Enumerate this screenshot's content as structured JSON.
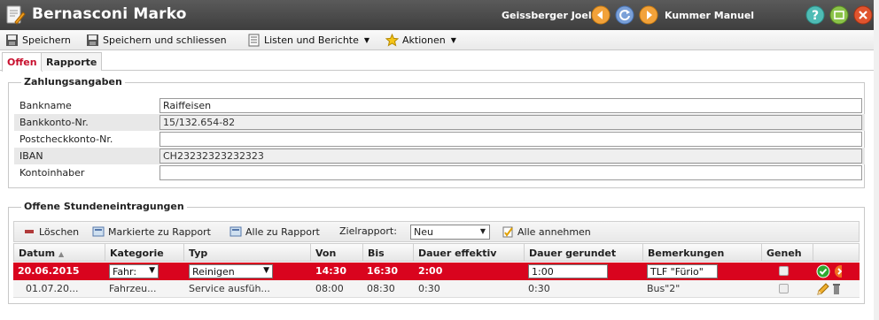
{
  "window": {
    "title": "Bernasconi Marko",
    "prev_name": "Geissberger Joel",
    "next_name": "Kummer Manuel"
  },
  "toolbar": {
    "save": "Speichern",
    "save_close": "Speichern und schliessen",
    "lists": "Listen und Berichte",
    "actions": "Aktionen"
  },
  "tabs": [
    "Offen",
    "Rapporte"
  ],
  "payment": {
    "legend": "Zahlungsangaben",
    "fields": [
      {
        "label": "Bankname",
        "value": ""
      },
      {
        "label": "Bankkonto-Nr.",
        "value": "15/132.654-82"
      },
      {
        "label": "Postcheckkonto-Nr.",
        "value": ""
      },
      {
        "label": "IBAN",
        "value": "CH23232323232323"
      },
      {
        "label": "Kontoinhaber",
        "value": ""
      }
    ],
    "bankname_value": "Raiffeisen"
  },
  "entries": {
    "legend": "Offene Stundeneintragungen",
    "toolbar": {
      "delete": "Löschen",
      "mark_to_report": "Markierte zu Rapport",
      "all_to_report": "Alle zu Rapport",
      "target_label": "Zielrapport:",
      "target_value": "Neu",
      "accept_all": "Alle annehmen"
    },
    "columns": [
      "Datum",
      "Kategorie",
      "Typ",
      "Von",
      "Bis",
      "Dauer effektiv",
      "Dauer gerundet",
      "Bemerkungen",
      "Geneh"
    ],
    "rows": [
      {
        "date": "20.06.2015",
        "category": "Fahr:",
        "type": "Reinigen",
        "from": "14:30",
        "to": "16:30",
        "eff": "2:00",
        "rounded": "1:00",
        "remark": "TLF \"Fürio\""
      },
      {
        "date": "01.07.20...",
        "category": "Fahrzeu...",
        "type": "Service ausfüh...",
        "from": "08:00",
        "to": "08:30",
        "eff": "0:30",
        "rounded": "0:30",
        "remark": "Bus\"2\""
      }
    ]
  },
  "colors": {
    "titlebar": "#484848",
    "selected_row": "#d9041e",
    "active_tab": "#c8102e"
  }
}
